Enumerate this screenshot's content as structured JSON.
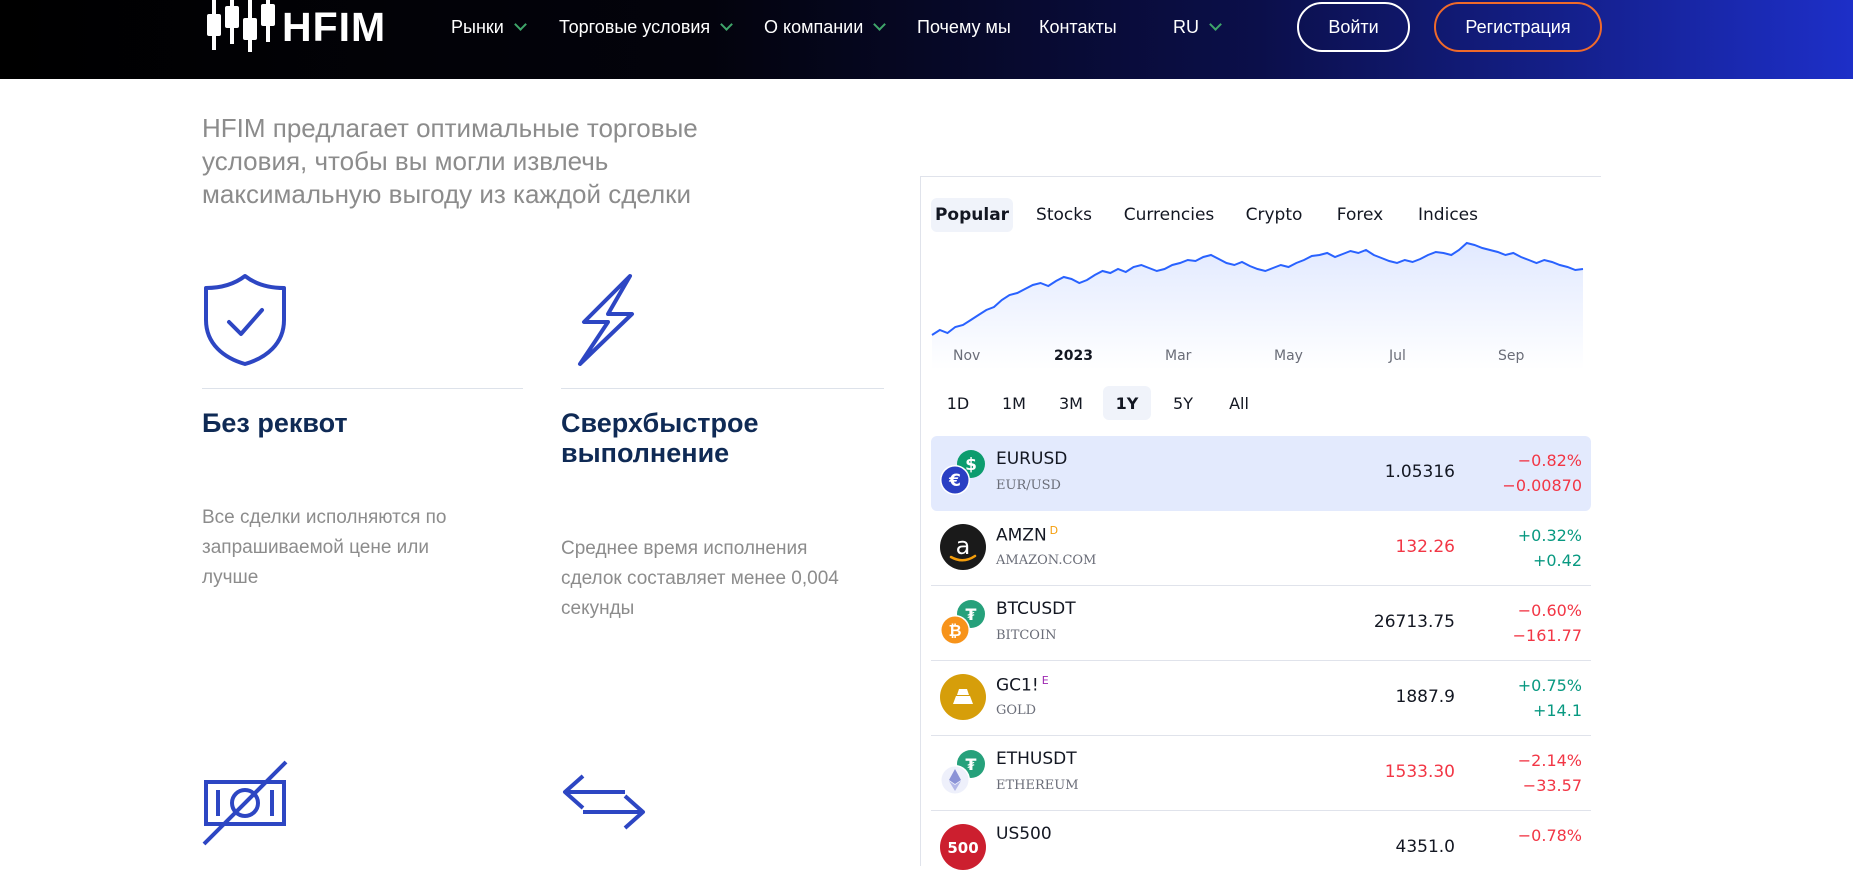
{
  "header": {
    "logo_text": "HFIM",
    "nav": [
      {
        "label": "Рынки",
        "has_dropdown": true
      },
      {
        "label": "Торговые условия",
        "has_dropdown": true
      },
      {
        "label": "О компании",
        "has_dropdown": true
      },
      {
        "label": "Почему мы",
        "has_dropdown": false
      },
      {
        "label": "Контакты",
        "has_dropdown": false
      },
      {
        "label": "RU",
        "has_dropdown": true
      }
    ],
    "login_label": "Войти",
    "register_label": "Регистрация"
  },
  "hero": {
    "headline": "HFIM предлагает оптимальные торговые условия, чтобы вы могли извлечь максимальную выгоду из каждой сделки"
  },
  "features": [
    {
      "icon": "shield-check-icon",
      "title": "Без реквот",
      "description": "Все сделки исполняются по запрашиваемой цене или лучше"
    },
    {
      "icon": "lightning-icon",
      "title": "Сверхбыстрое выполнение",
      "description": "Среднее время исполнения сделок составляет менее 0,004 секунды"
    },
    {
      "icon": "no-money-icon"
    },
    {
      "icon": "exchange-arrows-icon"
    }
  ],
  "widget": {
    "tabs": [
      "Popular",
      "Stocks",
      "Currencies",
      "Crypto",
      "Forex",
      "Indices"
    ],
    "active_tab": "Popular",
    "x_labels": [
      "Nov",
      "2023",
      "Mar",
      "May",
      "Jul",
      "Sep"
    ],
    "ranges": [
      "1D",
      "1M",
      "3M",
      "1Y",
      "5Y",
      "All"
    ],
    "active_range": "1Y",
    "rows": [
      {
        "symbol": "EURUSD",
        "sup": "",
        "name": "EUR/USD",
        "price": "1.05316",
        "price_color": "neutral",
        "change_pct": "−0.82%",
        "change_abs": "−0.00870",
        "direction": "down",
        "icon": "euro-dollar-icon",
        "selected": true
      },
      {
        "symbol": "AMZN",
        "sup": "D",
        "name": "AMAZON.COM",
        "price": "132.26",
        "price_color": "red",
        "change_pct": "+0.32%",
        "change_abs": "+0.42",
        "direction": "up",
        "icon": "amazon-icon",
        "selected": false
      },
      {
        "symbol": "BTCUSDT",
        "sup": "",
        "name": "BITCOIN",
        "price": "26713.75",
        "price_color": "neutral",
        "change_pct": "−0.60%",
        "change_abs": "−161.77",
        "direction": "down",
        "icon": "bitcoin-tether-icon",
        "selected": false
      },
      {
        "symbol": "GC1!",
        "sup": "E",
        "name": "GOLD",
        "price": "1887.9",
        "price_color": "neutral",
        "change_pct": "+0.75%",
        "change_abs": "+14.1",
        "direction": "up",
        "icon": "gold-icon",
        "selected": false
      },
      {
        "symbol": "ETHUSDT",
        "sup": "",
        "name": "ETHEREUM",
        "price": "1533.30",
        "price_color": "red",
        "change_pct": "−2.14%",
        "change_abs": "−33.57",
        "direction": "down",
        "icon": "ethereum-tether-icon",
        "selected": false
      },
      {
        "symbol": "US500",
        "sup": "",
        "name": "",
        "price": "4351.0",
        "price_color": "neutral",
        "change_pct": "−0.78%",
        "change_abs": "",
        "direction": "down",
        "icon": "sp500-icon",
        "selected": false
      }
    ]
  },
  "chart_data": {
    "type": "area",
    "title": "",
    "x_ticks": [
      "Nov",
      "2023",
      "Mar",
      "May",
      "Jul",
      "Sep"
    ],
    "series": [
      {
        "values": [
          1.2,
          1.25,
          1.22,
          1.28,
          1.3,
          1.35,
          1.4,
          1.45,
          1.48,
          1.55,
          1.6,
          1.62,
          1.66,
          1.7,
          1.72,
          1.69,
          1.74,
          1.78,
          1.76,
          1.72,
          1.75,
          1.8,
          1.84,
          1.82,
          1.86,
          1.83,
          1.88,
          1.9,
          1.87,
          1.84,
          1.86,
          1.9,
          1.92,
          1.95,
          1.94,
          1.98,
          2.0,
          1.96,
          1.92,
          1.9,
          1.93,
          1.89,
          1.86,
          1.84,
          1.87,
          1.9,
          1.88,
          1.92,
          1.95,
          1.99,
          2.0,
          2.02,
          1.98,
          2.01,
          2.04,
          2.02,
          2.05,
          2.0,
          1.97,
          1.94,
          1.92,
          1.95,
          1.93,
          1.96,
          2.0,
          2.03,
          2.02,
          2.0,
          2.05,
          2.12,
          2.1,
          2.07,
          2.05,
          2.03,
          2.0,
          2.02,
          1.98,
          1.95,
          1.92,
          1.95,
          1.93,
          1.9,
          1.88,
          1.85,
          1.86
        ]
      }
    ],
    "color": "#2962ff",
    "grid": false
  }
}
